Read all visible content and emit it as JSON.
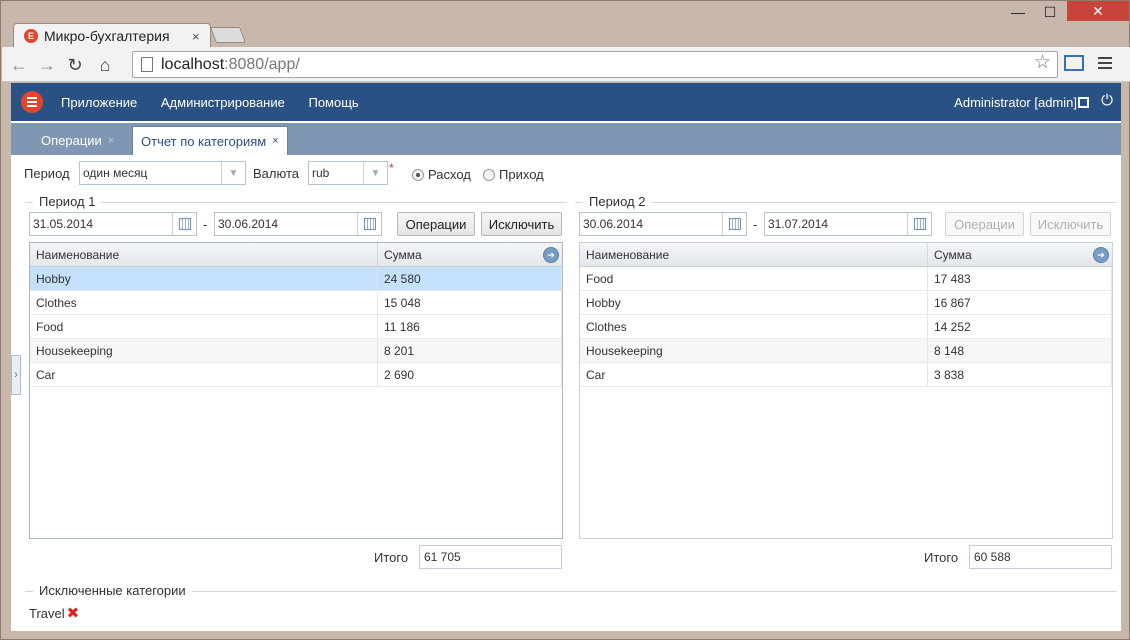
{
  "browser": {
    "tab_title": "Микро-бухгалтерия",
    "tab_close": "×",
    "url_host": "localhost",
    "url_rest": ":8080/app/",
    "win_min": "—",
    "win_max": "☐",
    "win_close": "✕",
    "back": "←",
    "forward": "→",
    "reload": "↻",
    "home": "⌂",
    "star": "☆"
  },
  "appbar": {
    "menu": [
      "Приложение",
      "Администрирование",
      "Помощь"
    ],
    "user": "Administrator [admin]",
    "logout_icon": "⏻"
  },
  "tabs": [
    {
      "label": "Операции",
      "close": "×"
    },
    {
      "label": "Отчет по категориям",
      "close": "×"
    }
  ],
  "sidehandle": "›",
  "filters": {
    "period_label": "Период",
    "period_value": "один месяц",
    "currency_label": "Валюта",
    "currency_value": "rub",
    "required_mark": "*",
    "arrow": "▼",
    "radio_expense": "Расход",
    "radio_income": "Приход"
  },
  "columns": {
    "name": "Наименование",
    "sum": "Сумма"
  },
  "period1": {
    "legend": "Период 1",
    "from": "31.05.2014",
    "to": "30.06.2014",
    "dash": "-",
    "ops_button": "Операции",
    "exclude_button": "Исключить",
    "rows": [
      {
        "name": "Hobby",
        "sum": "24 580"
      },
      {
        "name": "Clothes",
        "sum": "15 048"
      },
      {
        "name": "Food",
        "sum": "11 186"
      },
      {
        "name": "Housekeeping",
        "sum": "8 201"
      },
      {
        "name": "Car",
        "sum": "2 690"
      }
    ],
    "total_label": "Итого",
    "total": "61 705"
  },
  "period2": {
    "legend": "Период 2",
    "from": "30.06.2014",
    "to": "31.07.2014",
    "dash": "-",
    "ops_button": "Операции",
    "exclude_button": "Исключить",
    "rows": [
      {
        "name": "Food",
        "sum": "17 483"
      },
      {
        "name": "Hobby",
        "sum": "16 867"
      },
      {
        "name": "Clothes",
        "sum": "14 252"
      },
      {
        "name": "Housekeeping",
        "sum": "8 148"
      },
      {
        "name": "Car",
        "sum": "3 838"
      }
    ],
    "total_label": "Итого",
    "total": "60 588"
  },
  "excluded": {
    "legend": "Исключенные категории",
    "items": [
      {
        "name": "Travel",
        "icon": "✖"
      }
    ]
  },
  "grid_icon": "➔"
}
